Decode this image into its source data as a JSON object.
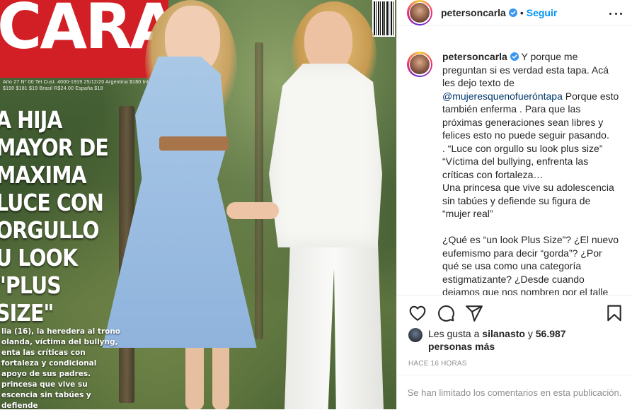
{
  "magazine": {
    "title": "CARAS",
    "fine_print": "Año 27 Nº 00 Tel Cust. 4000-1919  25/12/20 Argentina $180  Int. $181 $190 $181 $19 Brasil R$24.00 España $18",
    "headline": "A HIJA\nMAYOR DE\nMAXIMA\nLUCE CON\nORGULLO\nU LOOK\n\"PLUS SIZE\"",
    "subtext": "lia (16), la heredera al trono olanda, víctima del bullyng, enta las críticas con fortaleza y condicional apoyo de sus padres. princesa que vive su escencia sin tabúes y defiende"
  },
  "header": {
    "username": "petersoncarla",
    "separator": "•",
    "follow_label": "Seguir"
  },
  "caption": {
    "username": "petersoncarla",
    "text_1": " Y porque me preguntan si es verdad esta tapa. Acá les dejo texto de ",
    "mention": "@mujeresquenofueróntapa",
    "text_2": " Porque esto también enferma . Para que las próximas generaciones sean libres y felices esto no puede seguir pasando.\n. “Luce con orgullo su look plus size” “Víctima del bullying, enfrenta las críticas con fortaleza…\nUna princesa que vive su adolescencia sin tabúes y defiende su figura de “mujer real”\n\n¿Qué es “un look Plus Size”? ¿El nuevo eufemismo para decir “gorda”? ¿Por qué se usa como una categoría estigmatizante? ¿Desde cuando dejamos que nos nombren por el talle"
  },
  "icons": {
    "like": "heart-icon",
    "comment": "comment-icon",
    "share": "share-icon",
    "save": "bookmark-icon",
    "verified": "verified-badge-icon",
    "more": "more-options-icon"
  },
  "likes": {
    "prefix": "Les gusta a ",
    "user": "silanasto",
    "middle": " y ",
    "count": "56.987 personas más"
  },
  "time_ago": "HACE 16 HORAS",
  "comments_notice": "Se han limitado los comentarios en esta publicación.",
  "colors": {
    "accent": "#0095f6",
    "verified": "#3897f0",
    "masthead": "#d21f26",
    "muted": "#8e8e8e"
  }
}
